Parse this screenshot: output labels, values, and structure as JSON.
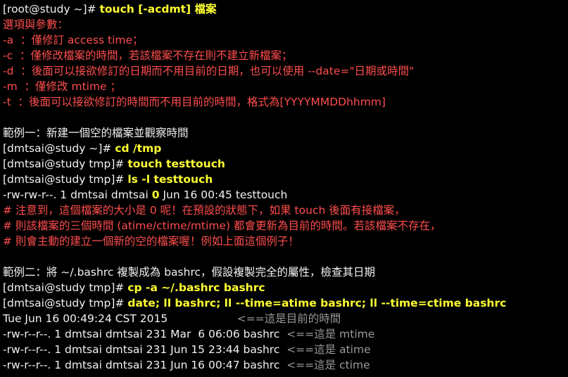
{
  "colors": {
    "background": "#000000",
    "prompt_text": "#f2f2f2",
    "command_text": "#ffff33",
    "option_text": "#ff4d4d",
    "comment_gray": "#9a9a9a"
  },
  "lines": [
    [
      {
        "t": "[root@study ~]# ",
        "c": "w"
      },
      {
        "t": "touch [-acdmt] 檔案",
        "c": "y"
      }
    ],
    [
      {
        "t": "選項與參數：",
        "c": "r"
      }
    ],
    [
      {
        "t": "-a  ：僅修訂 access time；",
        "c": "r"
      }
    ],
    [
      {
        "t": "-c  ：僅修改檔案的時間，若該檔案不存在則不建立新檔案；",
        "c": "r"
      }
    ],
    [
      {
        "t": "-d  ：後面可以接欲修訂的日期而不用目前的日期，也可以使用 --date=\"日期或時間\"",
        "c": "r"
      }
    ],
    [
      {
        "t": "-m  ：僅修改 mtime ；",
        "c": "r"
      }
    ],
    [
      {
        "t": "-t  ：後面可以接欲修訂的時間而不用目前的時間，格式為[YYYYMMDDhhmm]",
        "c": "r"
      }
    ],
    [],
    [
      {
        "t": "範例一：新建一個空的檔案並觀察時間",
        "c": "w"
      }
    ],
    [
      {
        "t": "[dmtsai@study ~]# ",
        "c": "w"
      },
      {
        "t": "cd /tmp",
        "c": "y"
      }
    ],
    [
      {
        "t": "[dmtsai@study tmp]# ",
        "c": "w"
      },
      {
        "t": "touch testtouch",
        "c": "y"
      }
    ],
    [
      {
        "t": "[dmtsai@study tmp]# ",
        "c": "w"
      },
      {
        "t": "ls -l testtouch",
        "c": "y"
      }
    ],
    [
      {
        "t": "-rw-rw-r--. 1 dmtsai dmtsai ",
        "c": "w"
      },
      {
        "t": "0",
        "c": "y"
      },
      {
        "t": " Jun 16 00:45 testtouch",
        "c": "w"
      }
    ],
    [
      {
        "t": "# 注意到，這個檔案的大小是 0 呢！在預設的狀態下，如果 touch 後面有接檔案，",
        "c": "r"
      }
    ],
    [
      {
        "t": "# 則該檔案的三個時間 (atime/ctime/mtime) 都會更新為目前的時間。若該檔案不存在，",
        "c": "r"
      }
    ],
    [
      {
        "t": "# 則會主動的建立一個新的空的檔案喔！例如上面這個例子！",
        "c": "r"
      }
    ],
    [],
    [
      {
        "t": "範例二：將 ~/.bashrc 複製成為 bashrc，假設複製完全的屬性，檢查其日期",
        "c": "w"
      }
    ],
    [
      {
        "t": "[dmtsai@study tmp]# ",
        "c": "w"
      },
      {
        "t": "cp -a ~/.bashrc bashrc",
        "c": "y"
      }
    ],
    [
      {
        "t": "[dmtsai@study tmp]# ",
        "c": "w"
      },
      {
        "t": "date; ll bashrc; ll --time=atime bashrc; ll --time=ctime bashrc",
        "c": "y"
      }
    ],
    [
      {
        "t": "Tue Jun 16 00:49:24 CST 2015                    ",
        "c": "w"
      },
      {
        "t": "<==這是目前的時間",
        "c": "g"
      }
    ],
    [
      {
        "t": "-rw-r--r--. 1 dmtsai dmtsai 231 Mar  6 06:06 bashrc  ",
        "c": "w"
      },
      {
        "t": "<==這是 mtime",
        "c": "g"
      }
    ],
    [
      {
        "t": "-rw-r--r--. 1 dmtsai dmtsai 231 Jun 15 23:44 bashrc  ",
        "c": "w"
      },
      {
        "t": "<==這是 atime",
        "c": "g"
      }
    ],
    [
      {
        "t": "-rw-r--r--. 1 dmtsai dmtsai 231 Jun 16 00:47 bashrc  ",
        "c": "w"
      },
      {
        "t": "<==這是 ctime",
        "c": "g"
      }
    ]
  ]
}
